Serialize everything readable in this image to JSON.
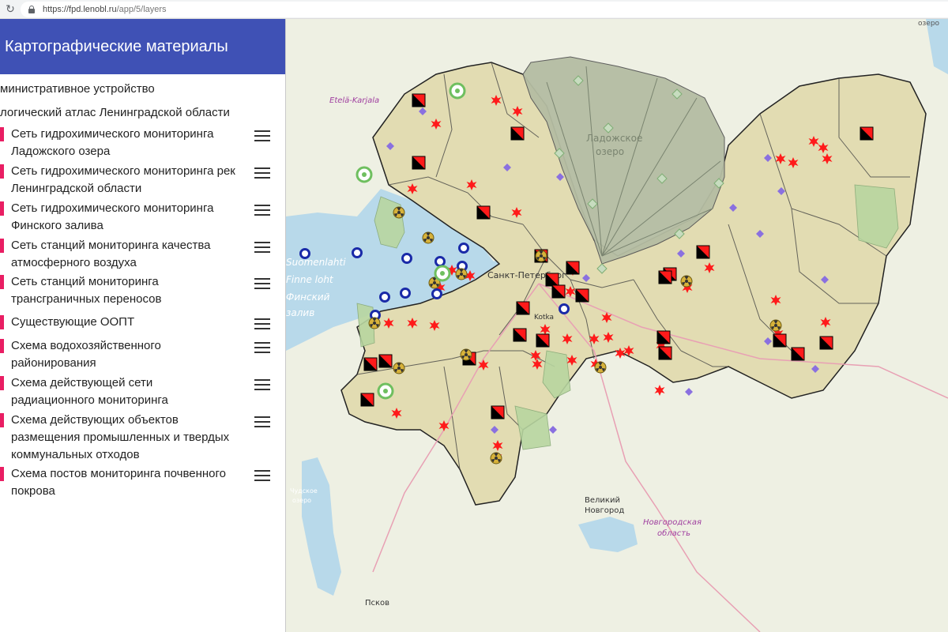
{
  "browser": {
    "url_host": "https://fpd.lenobl.ru",
    "url_path": "/app/5/layers"
  },
  "sidebar": {
    "title": "Картографические материалы",
    "groups": [
      "министративное устройство",
      "логический атлас Ленинградской области"
    ],
    "layers": [
      {
        "line1": "Сеть гидрохимического мониторинга",
        "line2": "Ладожского озера"
      },
      {
        "line1": "Сеть гидрохимического мониторинга рек",
        "line2": "Ленинградской области"
      },
      {
        "line1": "Сеть гидрохимического мониторинга",
        "line2": "Финского залива"
      },
      {
        "line1": "Сеть станций мониторинга качества",
        "line2": "атмосферного воздуха"
      },
      {
        "line1": "Сеть станций мониторинга",
        "line2": "трансграничных переносов"
      },
      {
        "line1": "Существующие ООПТ",
        "line2": ""
      },
      {
        "line1": "Схема водохозяйственного",
        "line2": "районирования"
      },
      {
        "line1": "Схема действующей сети",
        "line2": "радиационного мониторинга"
      },
      {
        "line1": "Схема действующих объектов",
        "line2": "размещения промышленных и твердых",
        "line3": "коммунальных отходов"
      },
      {
        "line1": "Схема постов мониторинга почвенного",
        "line2": "покрова"
      }
    ]
  },
  "map": {
    "labels": {
      "etela_karjala": "Etelä-Karjala",
      "ladozhskoe_1": "Ладожское",
      "ladozhskoe_2": "озеро",
      "spb": "Санкт-Петербург",
      "kotka": "Kotka",
      "velikiy_1": "Великий",
      "velikiy_2": "Новгород",
      "novg_obl_1": "Новгородская",
      "novg_obl_2": "область",
      "pskov": "Псков",
      "ozero": "озеро",
      "finland_1": "Suomenlahti",
      "finland_2": "Finne loht",
      "finland_3": "Финский",
      "finland_4": "залив",
      "chud_1": "Чудское",
      "chud_2": "озеро"
    },
    "colors": {
      "land": "#eef0e3",
      "region": "#e2dcb2",
      "lake": "#b8d9ea",
      "ladoga": "#b5bda3",
      "green": "#b8d6a0",
      "road": "#e8a0b4",
      "marker_red": "#ff1a1a",
      "marker_blue": "#1a2aa8",
      "marker_violet": "#8a70e0",
      "marker_yellow": "#d7b23a"
    },
    "marker_icons": [
      "red-star-icon",
      "black-red-square-icon",
      "blue-ring-icon",
      "violet-diamond-icon",
      "radiation-icon",
      "green-circle-icon",
      "green-diamond-icon"
    ]
  }
}
